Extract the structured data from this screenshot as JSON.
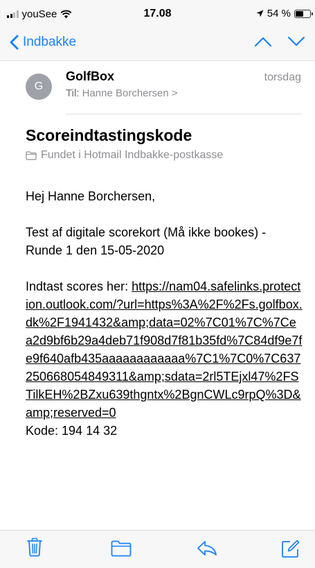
{
  "status_bar": {
    "carrier": "youSee",
    "time": "17.08",
    "battery_text": "54 %",
    "battery_level": 0.54
  },
  "nav": {
    "back_label": "Indbakke"
  },
  "message": {
    "avatar_initial": "G",
    "sender": "GolfBox",
    "date": "torsdag",
    "to_label": "Til:",
    "to_name": "Hanne Borchersen >",
    "subject": "Scoreindtastingskode",
    "folder": "Fundet i Hotmail Indbakke-postkasse",
    "greeting": "Hej Hanne Borchersen,",
    "intro": "Test af digitale scorekort (Må ikke bookes) - Runde 1 den 15-05-2020",
    "link_prefix": "Indtast scores her: ",
    "link": "https://nam04.safelinks.protection.outlook.com/?url=https%3A%2F%2Fs.golfbox.dk%2F1941432&amp;data=02%7C01%7C%7Cea2d9bf6b29a4deb71f908d7f81b35fd%7C84df9e7fe9f640afb435aaaaaaaaaaaa%7C1%7C0%7C637250668054849311&amp;sdata=2rl5TEjxl47%2FSTilkEH%2BZxu639thgntx%2BgnCWLc9rpQ%3D&amp;reserved=0",
    "code": "Kode: 194 14 32"
  },
  "toolbar": {
    "icons": [
      "trash-icon",
      "folder-icon",
      "reply-icon",
      "compose-icon"
    ]
  },
  "colors": {
    "accent": "#1a82fb",
    "bar_background": "#f7f7f7",
    "secondary_text": "#8e8e93"
  }
}
